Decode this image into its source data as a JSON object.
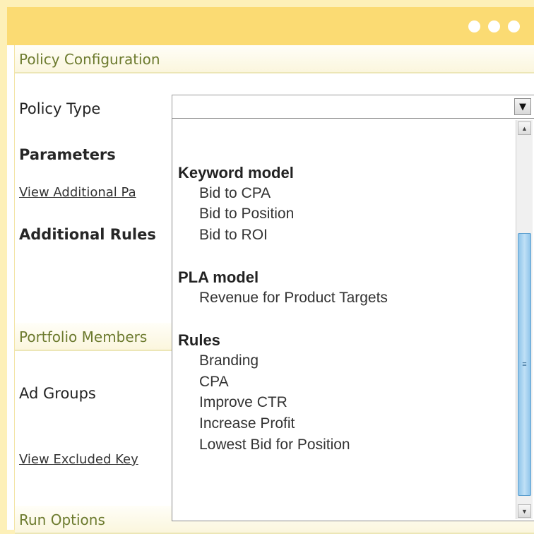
{
  "window": {
    "controls": [
      "dot",
      "dot",
      "dot"
    ]
  },
  "sections": {
    "policy_configuration": "Policy Configuration",
    "portfolio_members": "Portfolio Members",
    "run_options": "Run Options"
  },
  "labels": {
    "policy_type": "Policy Type",
    "parameters": "Parameters",
    "additional_rules": "Additional Rules",
    "ad_groups": "Ad Groups"
  },
  "links": {
    "view_additional_parameters": "View Additional Pa",
    "view_excluded_keywords": "View Excluded Key"
  },
  "policy_select": {
    "value": "",
    "arrow_icon": "triangle-down",
    "groups": [
      {
        "title": "Keyword model",
        "options": [
          "Bid to CPA",
          "Bid to Position",
          "Bid to ROI"
        ]
      },
      {
        "title": "PLA model",
        "options": [
          "Revenue for Product Targets"
        ]
      },
      {
        "title": "Rules",
        "options": [
          "Branding",
          "CPA",
          "Improve CTR",
          "Increase Profit",
          "Lowest Bid for Position"
        ]
      }
    ]
  },
  "scrollbar": {
    "position_fraction": 0.28,
    "visible_fraction": 0.68
  },
  "colors": {
    "titlebar": "#fbdb73",
    "section_text": "#6c7a2e",
    "scroll_thumb": "#8fc4ea"
  }
}
